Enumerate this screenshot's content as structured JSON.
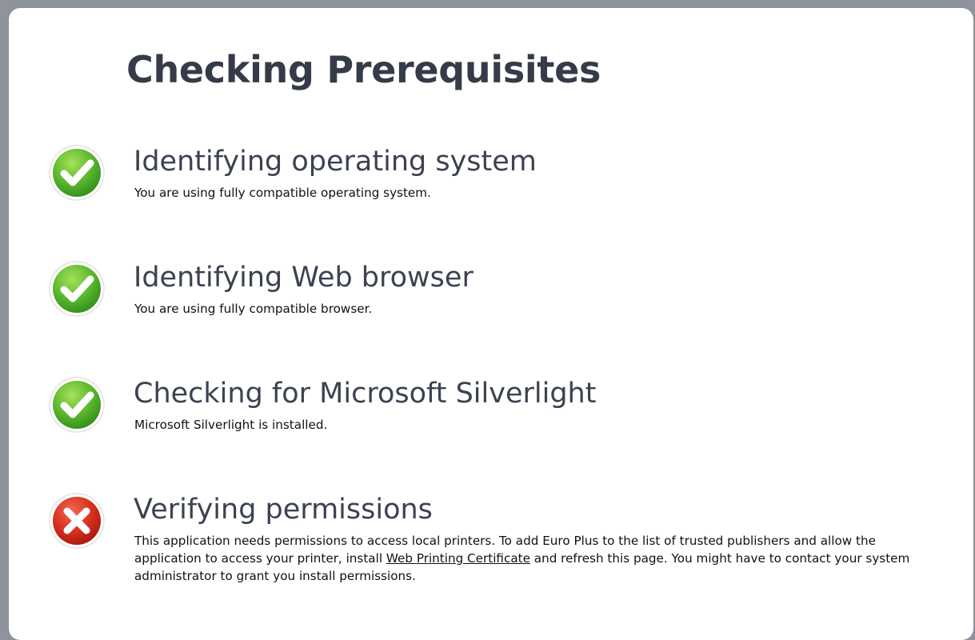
{
  "page": {
    "title": "Checking Prerequisites"
  },
  "checks": [
    {
      "status": "success",
      "icon": "check-icon",
      "title": "Identifying operating system",
      "description": "You are using fully compatible operating system."
    },
    {
      "status": "success",
      "icon": "check-icon",
      "title": "Identifying Web browser",
      "description": "You are using fully compatible browser."
    },
    {
      "status": "success",
      "icon": "check-icon",
      "title": "Checking for Microsoft Silverlight",
      "description": "Microsoft Silverlight is installed."
    },
    {
      "status": "error",
      "icon": "cross-icon",
      "title": "Verifying permissions",
      "description_before": "This application needs permissions to access local printers. To add Euro Plus to the list of trusted publishers and allow the application to access your printer, install ",
      "link_text": "Web Printing Certificate",
      "description_after": " and refresh this page. You might have to contact your system administrator to grant you install permissions."
    }
  ],
  "colors": {
    "success_green": "#5cb82e",
    "error_red": "#d8301f",
    "title_text": "#353b48",
    "background": "#8f939b"
  }
}
